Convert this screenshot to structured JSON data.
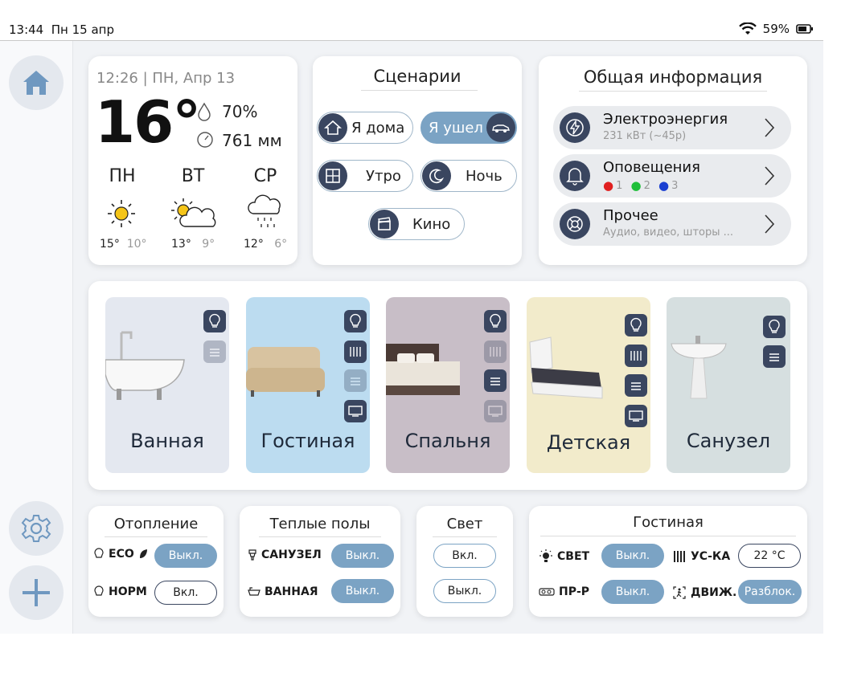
{
  "status": {
    "time": "13:44",
    "date": "Пн 15 апр",
    "battery": "59%"
  },
  "sidebar": {
    "home_icon": "home-icon",
    "settings_icon": "gear-icon",
    "add_icon": "plus-icon"
  },
  "weather": {
    "datetime": "12:26 | ПН, Апр 13",
    "temp": "16°",
    "humidity": "70%",
    "pressure": "761 мм",
    "days": [
      {
        "name": "ПН",
        "icon": "sun-icon",
        "hi": "15°",
        "lo": "10°"
      },
      {
        "name": "ВТ",
        "icon": "partly-cloudy-icon",
        "hi": "13°",
        "lo": "9°"
      },
      {
        "name": "СР",
        "icon": "snow-cloud-icon",
        "hi": "12°",
        "lo": "6°"
      }
    ]
  },
  "scenes": {
    "title": "Сценарии",
    "home": "Я дома",
    "away": "Я ушел",
    "morning": "Утро",
    "night": "Ночь",
    "cinema": "Кино"
  },
  "info": {
    "title": "Общая информация",
    "electricity": {
      "title": "Электроэнергия",
      "sub": "231 кВт (~45р)"
    },
    "alerts": {
      "title": "Оповещения",
      "c1": "1",
      "c2": "2",
      "c3": "3"
    },
    "other": {
      "title": "Прочее",
      "sub": "Аудио, видео, шторы ..."
    }
  },
  "rooms": {
    "bath": "Ванная",
    "living": "Гостиная",
    "bedroom": "Спальня",
    "kids": "Детская",
    "wc": "Санузел"
  },
  "heating": {
    "title": "Отопление",
    "eco": "ECO",
    "norm": "НОРМ",
    "eco_state": "Выкл.",
    "norm_state": "Вкл."
  },
  "floors": {
    "title": "Теплые полы",
    "wc": "САНУЗЕЛ",
    "bath": "ВАННАЯ",
    "wc_state": "Выкл.",
    "bath_state": "Выкл."
  },
  "light": {
    "title": "Свет",
    "on": "Вкл.",
    "off": "Выкл."
  },
  "living_panel": {
    "title": "Гостиная",
    "light": "СВЕТ",
    "light_state": "Выкл.",
    "heater": "УС-КА",
    "heater_value": "22 °C",
    "proj": "ПР-Р",
    "proj_state": "Выкл.",
    "motion": "ДВИЖ.",
    "motion_state": "Разблок."
  },
  "colors": {
    "accent": "#7ba3c4",
    "dark": "#3a4660",
    "bath_bg": "#e4e8f0",
    "living_bg": "#bcdcf0",
    "bed_bg": "#c8bec7",
    "kids_bg": "#f2ebcb",
    "wc_bg": "#d6dfe0"
  }
}
